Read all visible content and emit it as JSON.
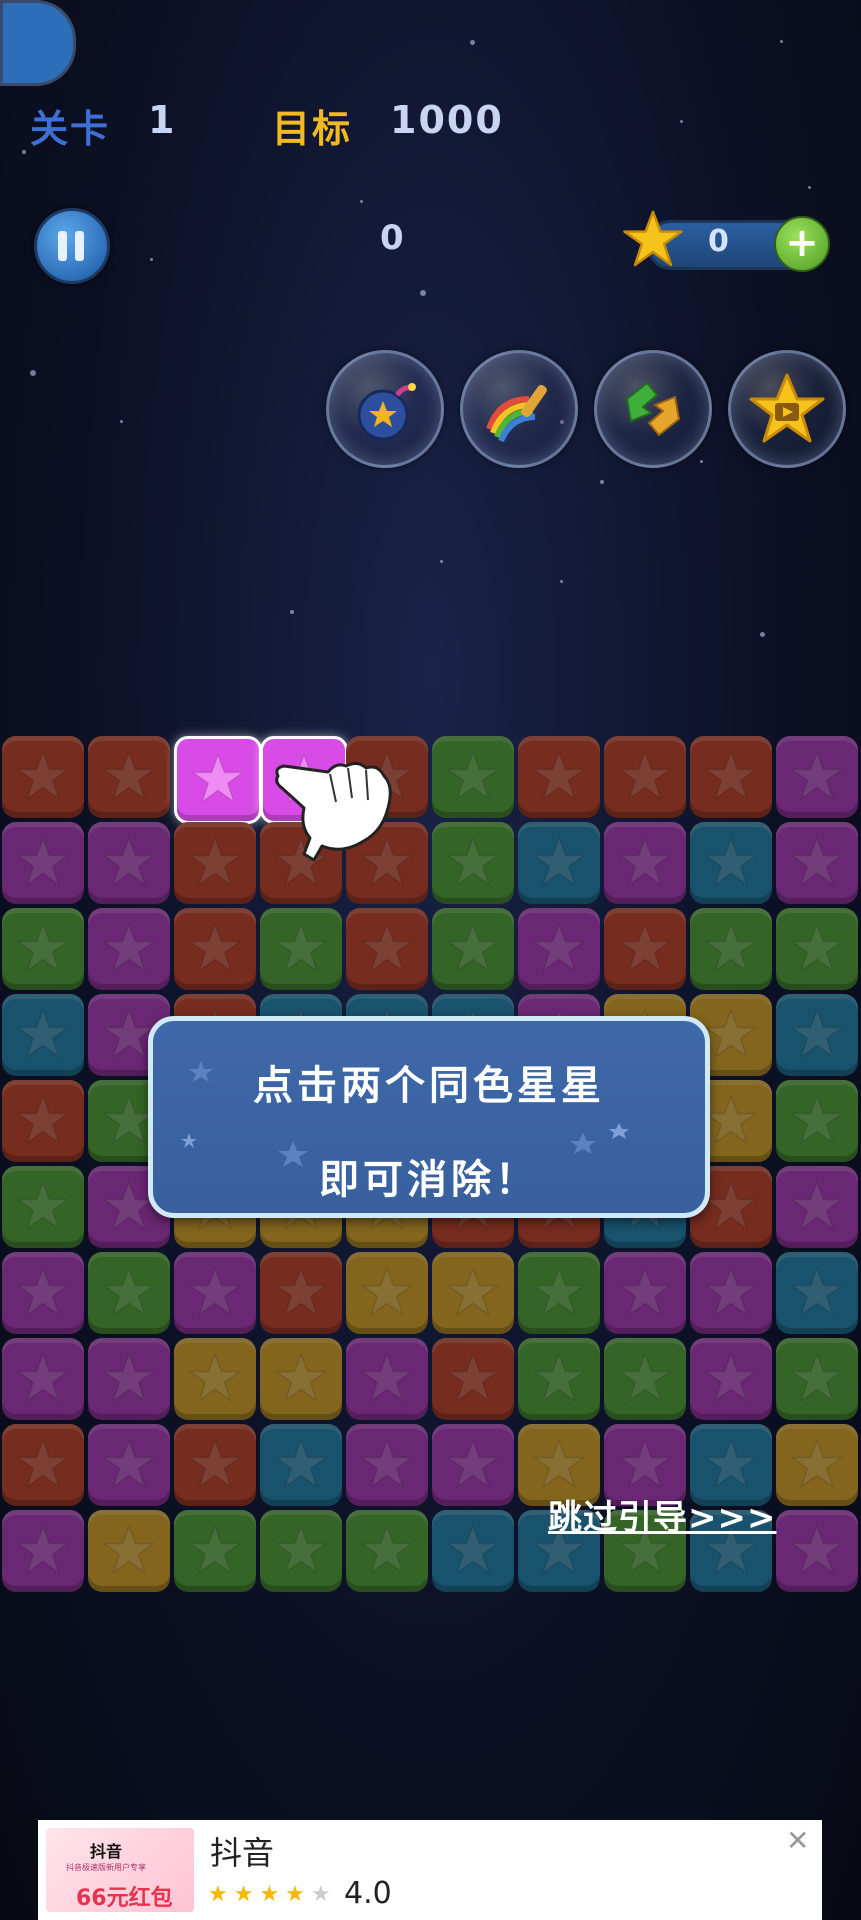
{
  "hud": {
    "level_label": "关卡",
    "level_value": "1",
    "target_label": "目标",
    "target_value": "1000",
    "score": "0",
    "coins": "0",
    "add_coins_symbol": "+"
  },
  "powerups": [
    {
      "name": "bomb"
    },
    {
      "name": "rainbow-brush"
    },
    {
      "name": "swap"
    },
    {
      "name": "video-star"
    }
  ],
  "board": {
    "colors": {
      "R": "#c9442c",
      "P": "#b43bc4",
      "G": "#4ea536",
      "B": "#1e86b4",
      "Y": "#d9a321"
    },
    "rows": [
      "RRPPRGRRRP",
      "PPRRRGBPBP",
      "GPRGRGPRGG",
      "BPRBBBPYYB",
      "RGRYYYYYYG",
      "GPYYYRRBRP",
      "PGPRYYGPPB",
      "PPYYPRGGPG",
      "RPRBPPYPBY",
      "PYGGGBBGBP"
    ],
    "highlighted_tiles": [
      [
        0,
        2
      ],
      [
        0,
        3
      ]
    ]
  },
  "guide": {
    "line1": "点击两个同色星星",
    "line2": "即可消除！",
    "skip": "跳过引导>>>"
  },
  "ad": {
    "thumb_brand": "抖音",
    "thumb_note": "抖音极速版新用户专享",
    "thumb_prize": "66元红包",
    "title": "抖音",
    "stars_filled": "★★★★",
    "stars_empty": "★",
    "rating": "4.0",
    "close": "✕"
  }
}
